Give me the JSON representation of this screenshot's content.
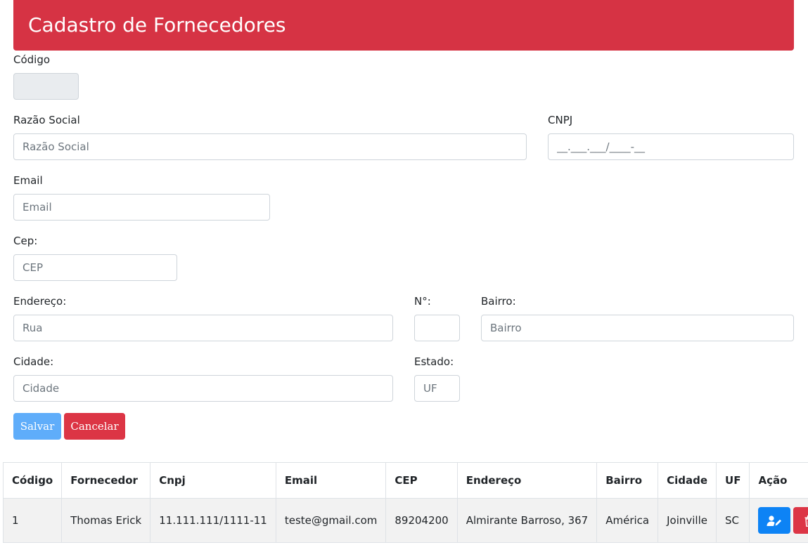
{
  "header": {
    "title": "Cadastro de Fornecedores"
  },
  "form": {
    "codigo": {
      "label": "Código",
      "value": ""
    },
    "razao_social": {
      "label": "Razão Social",
      "placeholder": "Razão Social"
    },
    "cnpj": {
      "label": "CNPJ",
      "placeholder": "__.___.___/____-__"
    },
    "email": {
      "label": "Email",
      "placeholder": "Email"
    },
    "cep": {
      "label": "Cep:",
      "placeholder": "CEP"
    },
    "endereco": {
      "label": "Endereço:",
      "placeholder": "Rua"
    },
    "numero": {
      "label": "N°:",
      "placeholder": ""
    },
    "bairro": {
      "label": "Bairro:",
      "placeholder": "Bairro"
    },
    "cidade": {
      "label": "Cidade:",
      "placeholder": "Cidade"
    },
    "estado": {
      "label": "Estado:",
      "placeholder": "UF"
    },
    "buttons": {
      "save": "Salvar",
      "cancel": "Cancelar"
    }
  },
  "table": {
    "headers": [
      "Código",
      "Fornecedor",
      "Cnpj",
      "Email",
      "CEP",
      "Endereço",
      "Bairro",
      "Cidade",
      "UF",
      "Ação"
    ],
    "rows": [
      {
        "codigo": "1",
        "fornecedor": "Thomas Erick",
        "cnpj": "11.111.111/1111-11",
        "email": "teste@gmail.com",
        "cep": "89204200",
        "endereco": "Almirante Barroso, 367",
        "bairro": "América",
        "cidade": "Joinville",
        "uf": "SC",
        "actions": {
          "edit_icon": "user-edit-icon",
          "delete_icon": "trash-icon"
        }
      }
    ]
  },
  "colors": {
    "header_bg": "#d63344",
    "save_button": "#5fadfa",
    "cancel_button": "#dc3545",
    "edit_button": "#0d83f5",
    "delete_button": "#dc3545"
  }
}
